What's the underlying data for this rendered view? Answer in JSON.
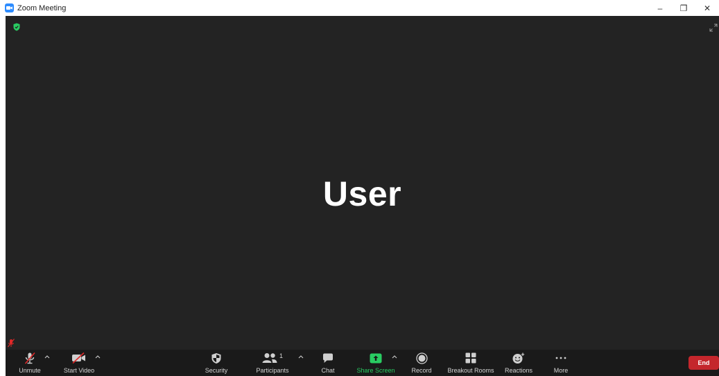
{
  "window": {
    "title": "Zoom Meeting",
    "minimize_symbol": "–",
    "restore_symbol": "❐",
    "close_symbol": "✕"
  },
  "meeting": {
    "participant_name": "User"
  },
  "toolbar": {
    "unmute_label": "Unmute",
    "start_video_label": "Start Video",
    "security_label": "Security",
    "participants_label": "Participants",
    "participants_count": "1",
    "chat_label": "Chat",
    "share_screen_label": "Share Screen",
    "record_label": "Record",
    "breakout_rooms_label": "Breakout Rooms",
    "reactions_label": "Reactions",
    "more_label": "More",
    "end_label": "End"
  },
  "colors": {
    "accent_blue": "#2d8cff",
    "share_green": "#29cc62",
    "end_red": "#c4262c",
    "stage_bg": "#232323",
    "toolbar_bg": "#1a1a1a"
  }
}
